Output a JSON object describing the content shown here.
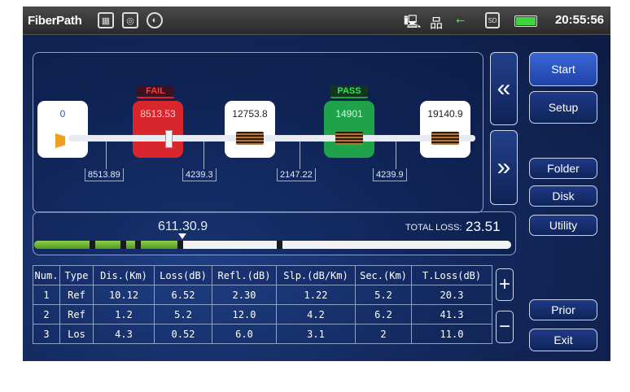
{
  "app": {
    "title": "FiberPath",
    "time": "20:55:56"
  },
  "status_icons": [
    "keyboard-icon",
    "screen-capture-icon",
    "contrast-icon",
    "computer-icon",
    "network-icon",
    "usb-icon",
    "sd-card-icon",
    "battery-icon"
  ],
  "trace": {
    "nodes": [
      {
        "value": "0",
        "status": ""
      },
      {
        "value": "8513.53",
        "status": "FAIL"
      },
      {
        "value": "12753.8",
        "status": ""
      },
      {
        "value": "14901",
        "status": "PASS"
      },
      {
        "value": "19140.9",
        "status": ""
      }
    ],
    "segments": [
      "8513.89",
      "4239.3",
      "2147.22",
      "4239.9"
    ],
    "colors": {
      "fail": "#d9262c",
      "pass": "#1ea34a"
    }
  },
  "position": {
    "cursor_value": "611.30.9",
    "total_loss_label": "TOTAL LOSS:",
    "total_loss_value": "23.51"
  },
  "table": {
    "headers": [
      "Num.",
      "Type",
      "Dis.(Km)",
      "Loss(dB)",
      "Refl.(dB)",
      "Slp.(dB/Km)",
      "Sec.(Km)",
      "T.Loss(dB)"
    ],
    "rows": [
      [
        "1",
        "Ref",
        "10.12",
        "6.52",
        "2.30",
        "1.22",
        "5.2",
        "20.3"
      ],
      [
        "2",
        "Ref",
        "1.2",
        "5.2",
        "12.0",
        "4.2",
        "6.2",
        "41.3"
      ],
      [
        "3",
        "Los",
        "4.3",
        "0.52",
        "6.0",
        "3.1",
        "2",
        "11.0"
      ]
    ]
  },
  "sidebar": {
    "start": "Start",
    "setup": "Setup",
    "folder": "Folder",
    "disk": "Disk",
    "utility": "Utility",
    "prior": "Prior",
    "exit": "Exit"
  },
  "nav": {
    "prev": "«",
    "next": "»",
    "plus": "+",
    "minus": "−"
  }
}
